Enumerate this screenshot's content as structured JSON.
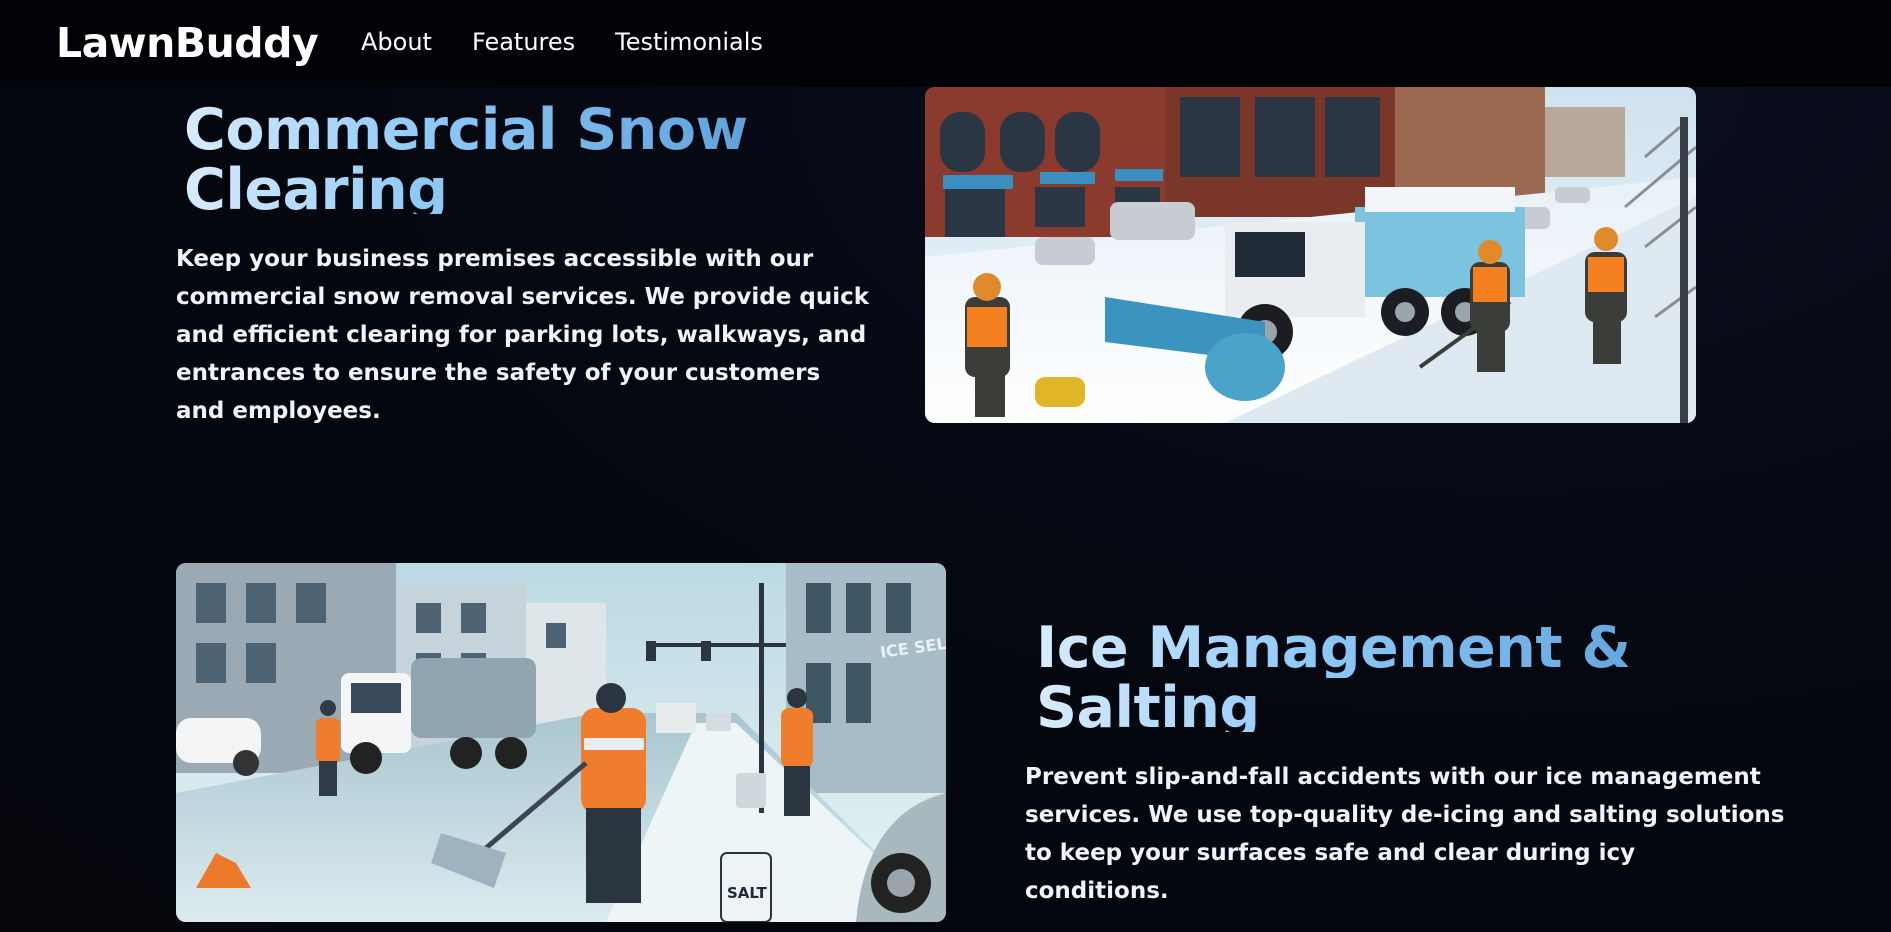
{
  "navbar": {
    "brand": "LawnBuddy",
    "links": [
      {
        "label": "About"
      },
      {
        "label": "Features"
      },
      {
        "label": "Testimonials"
      }
    ]
  },
  "sections": [
    {
      "title_line1": "Commercial Snow",
      "title_line2": "Clearing",
      "text": "Keep your business premises accessible with our commercial snow removal services. We provide quick and efficient clearing for parking lots, walkways, and entrances to ensure the safety of your customers and employees."
    },
    {
      "title_line1": "Ice Management &",
      "title_line2": "Salting",
      "text": "Prevent slip-and-fall accidents with our ice management services. We use top-quality de-icing and salting solutions to keep your surfaces safe and clear during icy conditions.",
      "image_labels": {
        "bucket": "SALT",
        "sign": "ICE SELLIN"
      }
    }
  ],
  "colors": {
    "background": "#05070f",
    "navbar": "#020306",
    "title_gradient_start": "#d8ecff",
    "title_gradient_end": "#5a9ed8",
    "text": "#f1f3f8"
  }
}
